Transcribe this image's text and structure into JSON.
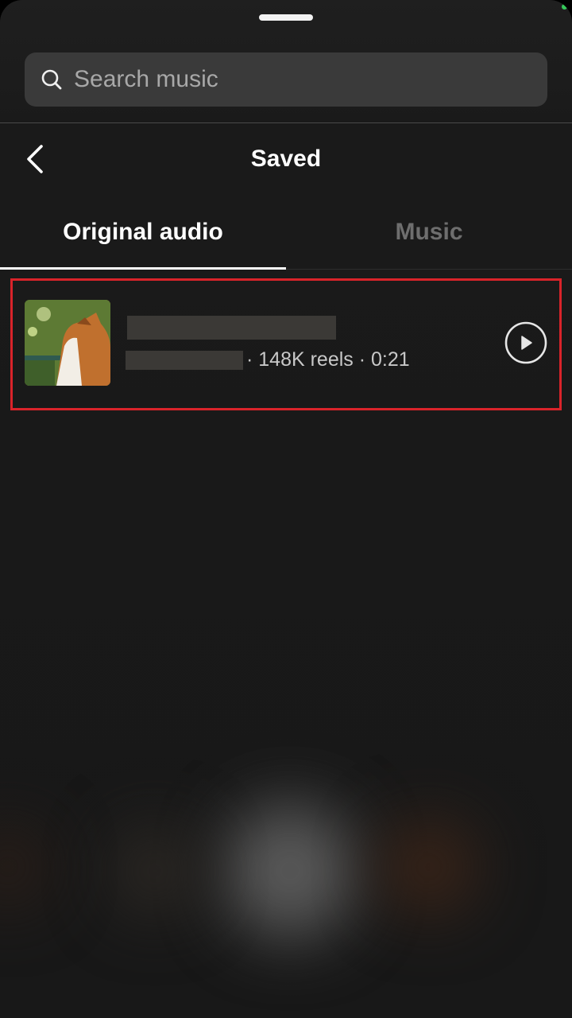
{
  "search": {
    "placeholder": "Search music"
  },
  "header": {
    "title": "Saved"
  },
  "tabs": [
    {
      "label": "Original audio",
      "active": true
    },
    {
      "label": "Music",
      "active": false
    }
  ],
  "items": [
    {
      "meta": "· 148K reels · 0:21",
      "reels": "148K reels",
      "duration": "0:21"
    }
  ],
  "icons": {
    "search": "search-icon",
    "back": "chevron-left-icon",
    "play": "play-circle-icon"
  },
  "colors": {
    "background": "#181818",
    "search_bar": "#3a3a3a",
    "active_tab": "#ffffff",
    "inactive_tab": "#6e6e6e",
    "highlight": "#d9232a",
    "status_dot": "#35c759"
  }
}
